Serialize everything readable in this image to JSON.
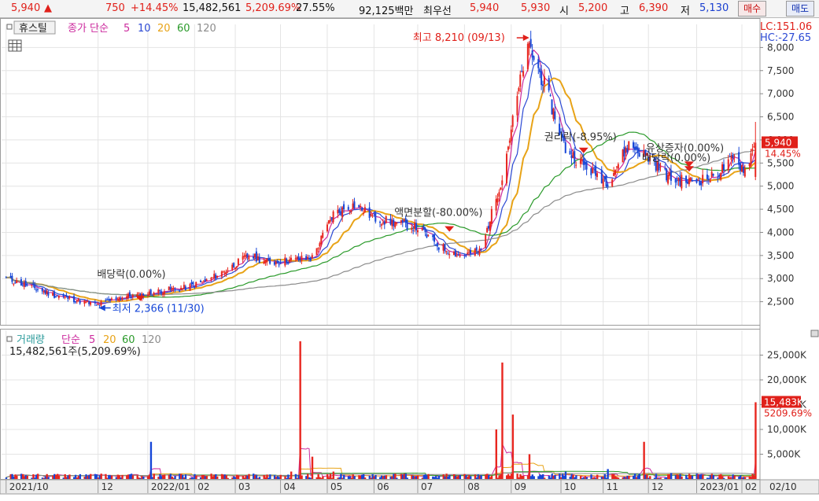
{
  "quote": {
    "price": "5,940",
    "arrow": "▲",
    "change": "750",
    "change_pct": "+14.45%",
    "volume": "15,482,561",
    "volume_ratio": "5,209.69%",
    "turnover_pct": "27.55%",
    "trade_amount": "92,125백만",
    "best_label": "최우선",
    "best_ask": "5,940",
    "best_bid": "5,930",
    "open_label": "시",
    "open": "5,200",
    "high_label": "고",
    "high": "6,390",
    "low_label": "저",
    "low": "5,130",
    "buy_label": "매수",
    "sell_label": "매도"
  },
  "price_panel": {
    "stock_name": "휴스틸",
    "legend_main": "종가 단순",
    "periods": [
      "5",
      "10",
      "20",
      "60",
      "120"
    ],
    "lc": "LC:151.06",
    "hc": "HC:-27.65",
    "current_price": "5,940",
    "current_pct": "14.45%",
    "annotations": [
      {
        "text": "최고 8,210 (09/13)",
        "arrow": "right",
        "date": "2022-09-13",
        "value": 8210
      },
      {
        "text": "최저 2,366 (11/30)",
        "arrow": "left",
        "date": "2021-11-30",
        "value": 2366
      },
      {
        "text": "배당락(0.00%)",
        "date": "2021-12-29",
        "value": 2650
      },
      {
        "text": "액면분할(-80.00%)",
        "date": "2022-07-22",
        "value": 4150
      },
      {
        "text": "권리락(-8.95%)",
        "date": "2022-10-19",
        "value": 5850
      },
      {
        "text": "배당락(0.00%)",
        "date": "2022-12-28",
        "value": 5450
      },
      {
        "text": "유상증자(0.00%)",
        "date": "2022-12-28",
        "value": 5550
      }
    ]
  },
  "volume_panel": {
    "legend_title": "거래량",
    "legend_main": "단순",
    "periods": [
      "5",
      "20",
      "60",
      "120"
    ],
    "summary": "15,482,561주(5,209.69%)",
    "current_volume": "15,483K",
    "current_pct": "5209.69%"
  },
  "colors": {
    "up": "#e8261f",
    "down": "#1747d8",
    "ma5": "#cc2b9e",
    "ma10": "#2b49d4",
    "ma20": "#e8a317",
    "ma60": "#2a9a2a",
    "ma120": "#8c8c8c",
    "marker": "#e0201a"
  },
  "chart_data": [
    {
      "type": "line",
      "name": "price",
      "note": "Daily candlestick price chart with simple moving averages",
      "x": [
        "2021-10-01",
        "2021-10-15",
        "2021-11-01",
        "2021-11-15",
        "2021-11-30",
        "2021-12-15",
        "2021-12-31",
        "2022-01-14",
        "2022-01-28",
        "2022-02-11",
        "2022-02-25",
        "2022-03-11",
        "2022-03-25",
        "2022-04-08",
        "2022-04-22",
        "2022-05-06",
        "2022-05-20",
        "2022-06-03",
        "2022-06-17",
        "2022-07-01",
        "2022-07-15",
        "2022-07-29",
        "2022-08-12",
        "2022-08-26",
        "2022-09-09",
        "2022-09-13",
        "2022-09-23",
        "2022-10-07",
        "2022-10-21",
        "2022-11-04",
        "2022-11-18",
        "2022-12-02",
        "2022-12-16",
        "2022-12-30",
        "2023-01-13",
        "2023-01-27",
        "2023-02-03",
        "2023-02-10"
      ],
      "close": [
        3000,
        2850,
        2650,
        2550,
        2420,
        2600,
        2650,
        2750,
        2800,
        2950,
        3200,
        3500,
        3350,
        3400,
        3450,
        4400,
        4600,
        4300,
        4200,
        4100,
        3700,
        3500,
        3600,
        5200,
        7600,
        8000,
        7200,
        5800,
        5400,
        5100,
        5900,
        5600,
        5150,
        5100,
        5200,
        5600,
        5350,
        5940
      ],
      "ylim": [
        2000,
        8500
      ],
      "yticks": [
        2500,
        3000,
        3500,
        4000,
        4500,
        5000,
        5500,
        6000,
        6500,
        7000,
        7500,
        8000
      ],
      "xticks": [
        "2021/10",
        "12",
        "2022/01",
        "02",
        "03",
        "04",
        "05",
        "06",
        "07",
        "08",
        "09",
        "10",
        "11",
        "12",
        "2023/01",
        "02"
      ],
      "x_cursor_label": "02/10"
    },
    {
      "type": "bar",
      "name": "volume",
      "x": [
        "2021-10-01",
        "2021-11-15",
        "2021-12-31",
        "2022-01-05",
        "2022-02-11",
        "2022-03-11",
        "2022-04-08",
        "2022-04-14",
        "2022-04-22",
        "2022-05-06",
        "2022-06-03",
        "2022-07-01",
        "2022-08-10",
        "2022-08-22",
        "2022-08-26",
        "2022-09-02",
        "2022-09-13",
        "2022-10-07",
        "2022-11-04",
        "2022-11-28",
        "2022-12-16",
        "2023-01-13",
        "2023-02-10"
      ],
      "values": [
        300,
        400,
        500,
        7500,
        600,
        1000,
        1500,
        27800,
        4500,
        1500,
        800,
        700,
        900,
        10000,
        23500,
        13000,
        5000,
        1500,
        2000,
        7500,
        1200,
        800,
        15483
      ],
      "unit": "K",
      "ylim": [
        0,
        30000
      ],
      "yticks": [
        5000,
        10000,
        15000,
        20000,
        25000
      ],
      "ytick_labels": [
        "5,000K",
        "10,000K",
        "15,000K",
        "20,000K",
        "25,000K"
      ]
    }
  ]
}
